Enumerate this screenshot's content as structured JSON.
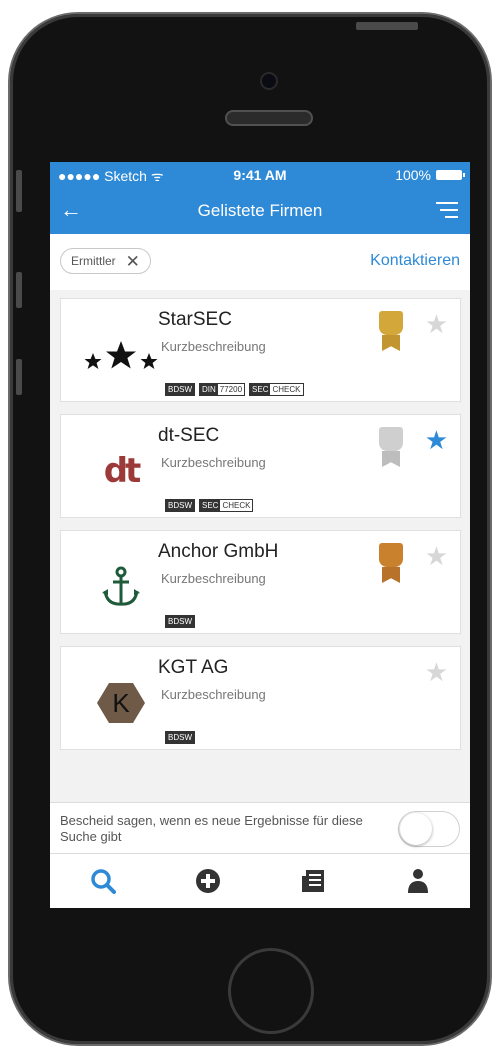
{
  "status_bar": {
    "carrier": "●●●●● Sketch ᯤ",
    "time": "9:41 AM",
    "battery": "100%"
  },
  "nav": {
    "title": "Gelistete Firmen",
    "back_icon": "arrow-left-icon",
    "filter_icon": "filter-icon"
  },
  "filter_chip": {
    "label": "Ermittler",
    "remove": "✕"
  },
  "contact_link": "Kontaktieren",
  "companies": [
    {
      "name": "StarSEC",
      "description": "Kurzbeschreibung",
      "logo": "three-stars-logo",
      "medal": "gold",
      "favorite": false,
      "badges": [
        [
          {
            "t": "BDSW",
            "s": "dark"
          }
        ],
        [
          {
            "t": "DIN",
            "s": "dark"
          },
          {
            "t": "77200",
            "s": "light"
          }
        ],
        [
          {
            "t": "SEC",
            "s": "dark"
          },
          {
            "t": "CHECK",
            "s": "light"
          }
        ]
      ]
    },
    {
      "name": "dt-SEC",
      "description": "Kurzbeschreibung",
      "logo": "dt-logo",
      "medal": "silver",
      "favorite": true,
      "badges": [
        [
          {
            "t": "BDSW",
            "s": "dark"
          }
        ],
        [
          {
            "t": "SEC",
            "s": "dark"
          },
          {
            "t": "CHECK",
            "s": "light"
          }
        ]
      ]
    },
    {
      "name": "Anchor GmbH",
      "description": "Kurzbeschreibung",
      "logo": "anchor-logo",
      "medal": "bronze",
      "favorite": false,
      "badges": [
        [
          {
            "t": "BDSW",
            "s": "dark"
          }
        ]
      ]
    },
    {
      "name": "KGT AG",
      "description": "Kurzbeschreibung",
      "logo": "hexagon-k-logo",
      "medal": null,
      "favorite": false,
      "badges": [
        [
          {
            "t": "BDSW",
            "s": "dark"
          }
        ]
      ]
    }
  ],
  "notify": {
    "text": "Bescheid sagen, wenn es neue Ergebnisse für diese Suche gibt",
    "enabled": false
  },
  "tabs": [
    "search-icon",
    "plus-circle-icon",
    "newspaper-icon",
    "person-icon"
  ],
  "colors": {
    "accent": "#2e8ad6",
    "gold": "#d4a73a",
    "silver": "#c9c9c9",
    "bronze": "#c9812e"
  }
}
